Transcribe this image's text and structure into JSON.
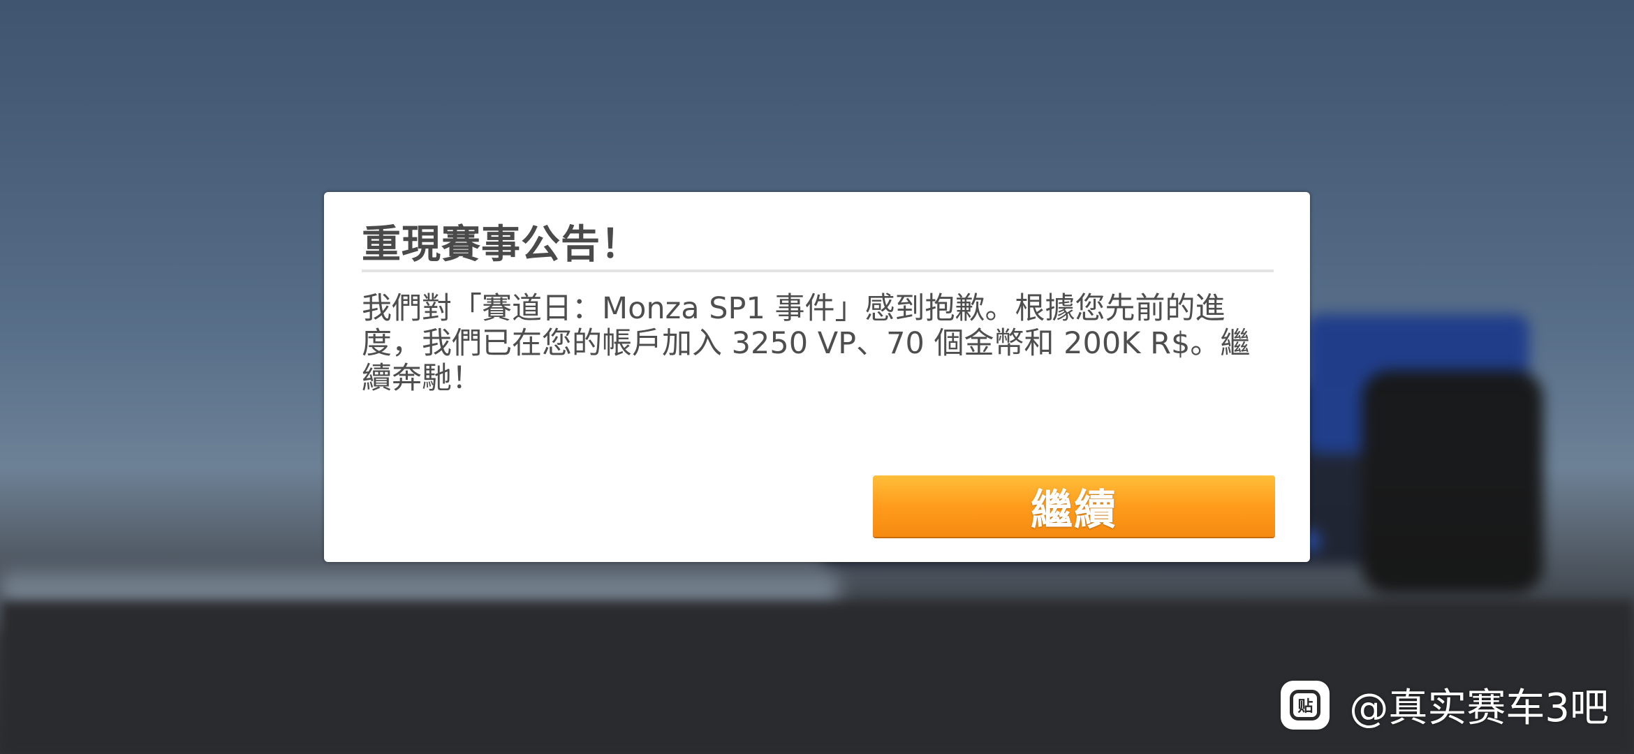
{
  "dialog": {
    "title": "重現賽事公告！",
    "message": "我們對「賽道日：Monza SP1 事件」感到抱歉。根據您先前的進度，我們已在您的帳戶加入 3250 VP、70 個金幣和 200K R$。繼續奔馳！",
    "continue_label": "繼續"
  },
  "watermark": {
    "icon": "tieba-icon",
    "logo_glyph": "贴",
    "text": "@真实赛车3吧"
  },
  "colors": {
    "button_top": "#ffbe3a",
    "button_bottom": "#f58a10",
    "title_text": "#4a4a4a",
    "dialog_bg": "#ffffff"
  }
}
